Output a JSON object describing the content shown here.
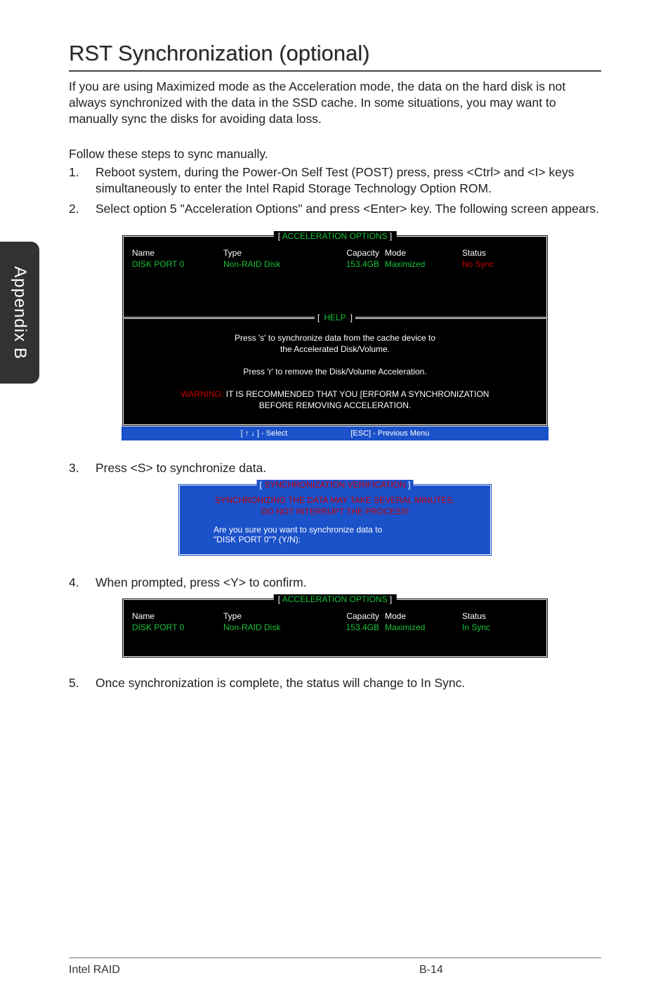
{
  "sideTab": "Appendix B",
  "heading": "RST Synchronization (optional)",
  "intro": "If you are using Maximized mode as the Acceleration mode, the data on the hard disk is not always synchronized with the data in the SSD cache. In some situations, you may want to manually sync the disks for avoiding data loss.",
  "followLine": "Follow these steps to sync manually.",
  "steps": {
    "s1": "Reboot system, during the Power-On Self Test (POST) press, press <Ctrl> and <I> keys simultaneously to enter the Intel Rapid Storage Technology Option ROM.",
    "s2": "Select option 5 \"Acceleration Options\" and press <Enter> key. The following screen appears.",
    "s3": "Press <S> to synchronize data.",
    "s4": "When prompted, press <Y> to confirm.",
    "s5": "Once synchronization is complete, the status will change to In Sync."
  },
  "bios1": {
    "title": "ACCELERATION OPTIONS",
    "headers": {
      "name": "Name",
      "type": "Type",
      "capacity": "Capacity",
      "mode": "Mode",
      "status": "Status"
    },
    "row": {
      "name": "DISK PORT 0",
      "type": "Non-RAID Disk",
      "capacity": "153.4GB",
      "mode": "Maximized",
      "status": "No Sync"
    },
    "helpTitle": "HELP",
    "help": {
      "l1": "Press 's' to synchronize data from the cache device to",
      "l2": "the Accelerated Disk/Volume.",
      "l3": "Press 'r' to remove the Disk/Volume Acceleration.",
      "warnPrefix": "WARNING:",
      "warnRest": " IT IS RECOMMENDED THAT YOU [ERFORM A SYNCHRONIZATION",
      "warn2": "BEFORE REMOVING ACCELERATION."
    },
    "footer": {
      "left": "[ ↑ ↓ ] - Select",
      "right": "[ESC] - Previous Menu"
    }
  },
  "syncBox": {
    "title": "SYNCHRONIZATION VERIFICATION",
    "l1": "SYNCHRONIZING THE DATA MAY TAKE SEVERAL MINUTES.",
    "l2": "DO NOT INTERRUPT THE PROCESS!",
    "l3": "Are you sure you want to synchronize data to",
    "l4": "\"DISK PORT 0\"? (Y/N):"
  },
  "bios2": {
    "title": "ACCELERATION OPTIONS",
    "headers": {
      "name": "Name",
      "type": "Type",
      "capacity": "Capacity",
      "mode": "Mode",
      "status": "Status"
    },
    "row": {
      "name": "DISK PORT 0",
      "type": "Non-RAID Disk",
      "capacity": "153.4GB",
      "mode": "Maximized",
      "status": "In Sync"
    }
  },
  "footer": {
    "left": "Intel RAID",
    "mid": "B-14"
  }
}
